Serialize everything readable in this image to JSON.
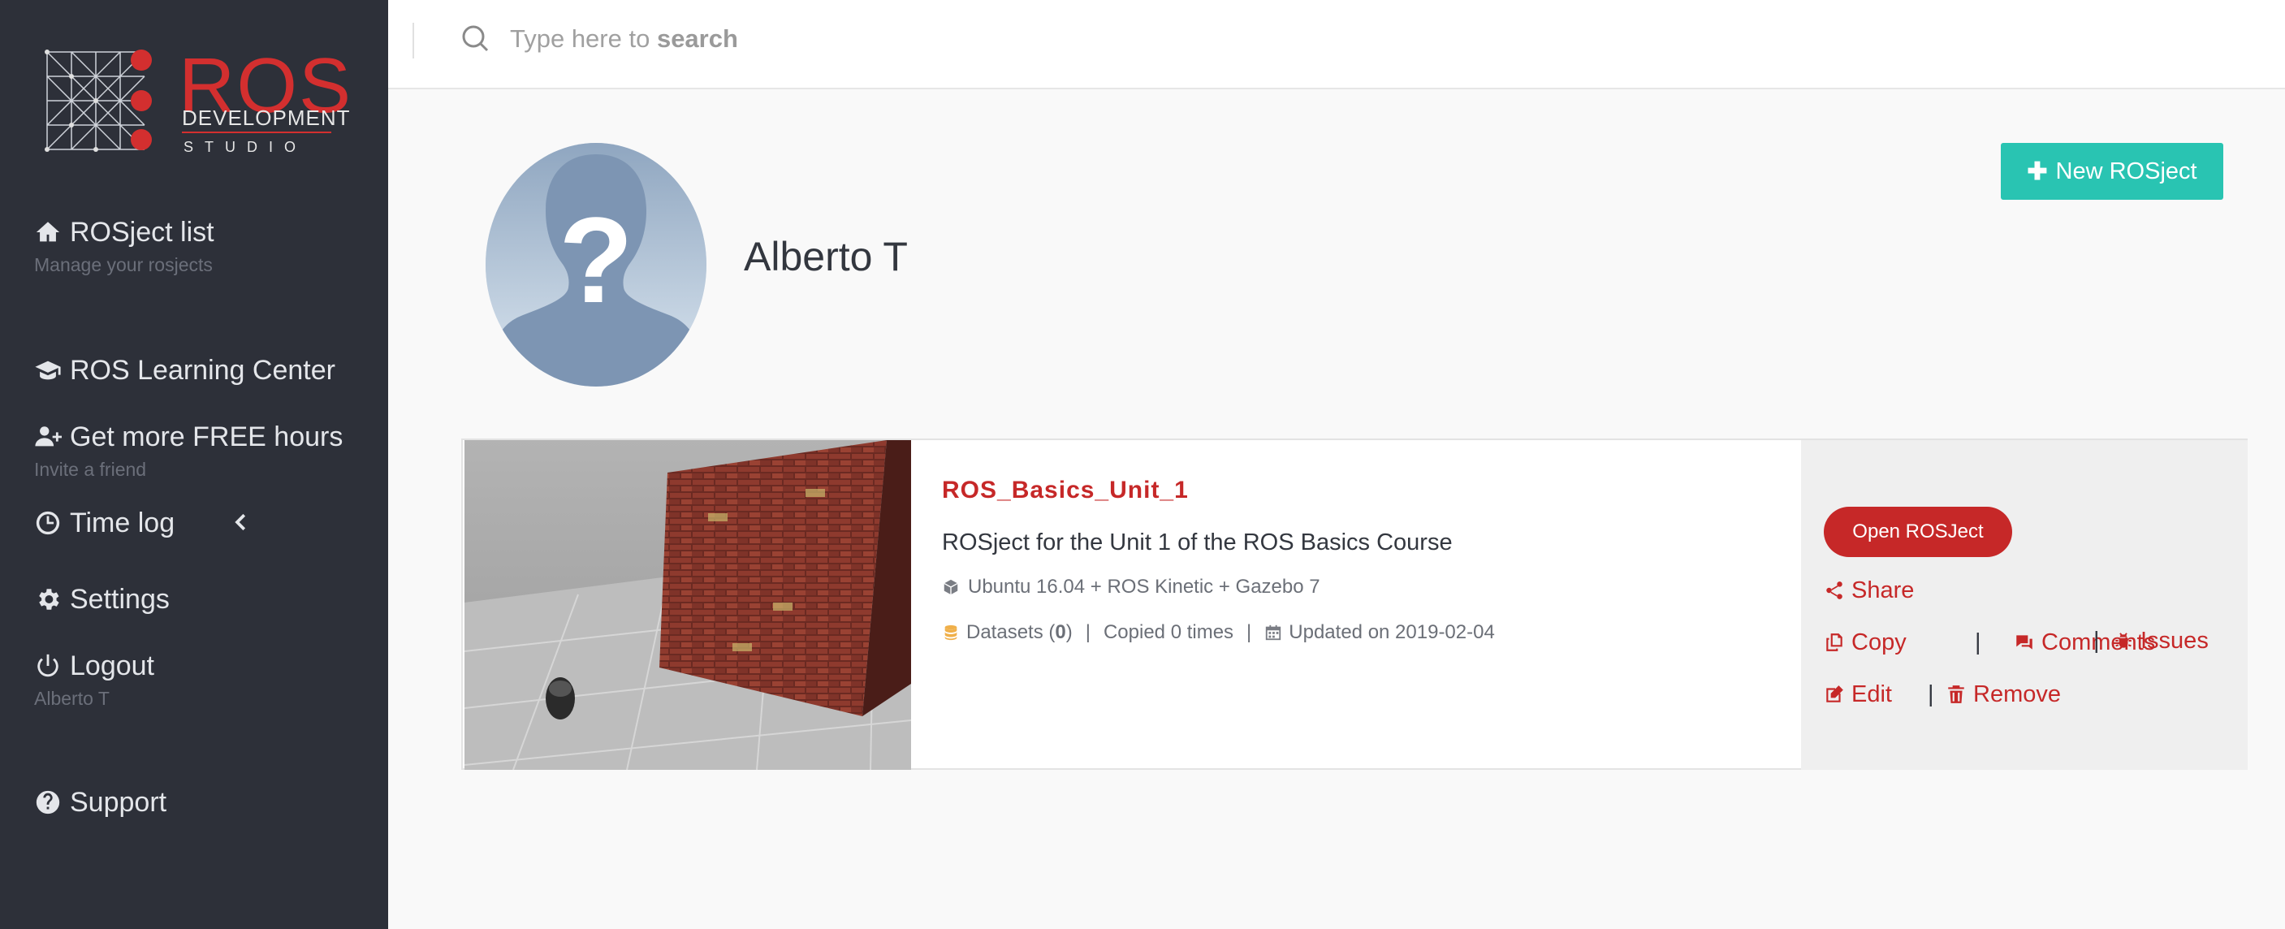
{
  "logo": {
    "word": "ROS",
    "line1": "DEVELOPMENT",
    "line2": "STUDIO"
  },
  "sidebar": {
    "items": [
      {
        "label": "ROSject list",
        "sub": "Manage your rosjects",
        "icon": "home-icon"
      },
      {
        "label": "ROS Learning Center",
        "icon": "graduation-cap-icon"
      },
      {
        "label": "Get more FREE hours",
        "sub": "Invite a friend",
        "icon": "user-plus-icon"
      },
      {
        "label": "Time log",
        "icon": "clock-icon"
      },
      {
        "label": "Settings",
        "icon": "gear-icon"
      },
      {
        "label": "Logout",
        "sub": "Alberto T",
        "icon": "power-icon"
      },
      {
        "label": "Support",
        "icon": "question-circle-icon"
      }
    ]
  },
  "search": {
    "placeholder_prefix": "Type here to ",
    "placeholder_bold": "search"
  },
  "profile": {
    "name": "Alberto T"
  },
  "toolbar": {
    "new_rosject_label": "New ROSject"
  },
  "rosject": {
    "title": "ROS_Basics_Unit_1",
    "description": "ROSject for the Unit 1 of the ROS Basics Course",
    "environment": "Ubuntu 16.04 + ROS Kinetic + Gazebo 7",
    "datasets_label": "Datasets (",
    "datasets_count": "0",
    "datasets_close": ")",
    "copied": "Copied 0 times",
    "updated": "Updated on 2019-02-04",
    "actions": {
      "open": "Open ROSJect",
      "share": "Share",
      "copy": "Copy",
      "comments": "Comments",
      "issues": "Issues",
      "edit": "Edit",
      "remove": "Remove"
    }
  },
  "colors": {
    "sidebar_bg": "#2d3039",
    "accent_red": "#c62828",
    "accent_teal": "#29c4b2",
    "page_bg": "#f9f9f9"
  }
}
